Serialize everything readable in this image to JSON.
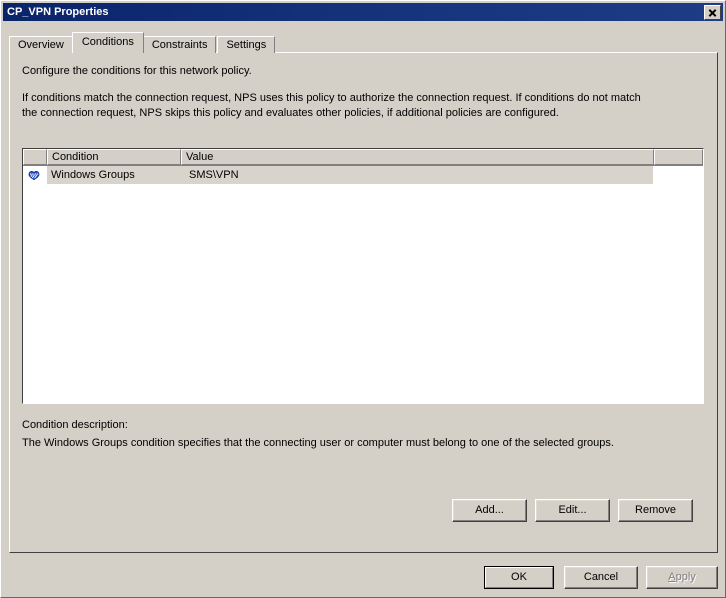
{
  "window": {
    "title": "CP_VPN Properties",
    "close_icon": "close-icon"
  },
  "tabs": [
    {
      "label": "Overview",
      "selected": false
    },
    {
      "label": "Conditions",
      "selected": true
    },
    {
      "label": "Constraints",
      "selected": false
    },
    {
      "label": "Settings",
      "selected": false
    }
  ],
  "panel": {
    "intro_line": "Configure the conditions for this network policy.",
    "detail_paragraph": "If conditions match the connection request, NPS uses this policy to authorize the connection request. If conditions do not match the connection request, NPS skips this policy and evaluates other policies, if additional policies are configured."
  },
  "listview": {
    "columns": [
      {
        "key": "icon",
        "label": ""
      },
      {
        "key": "condition",
        "label": "Condition"
      },
      {
        "key": "value",
        "label": "Value"
      },
      {
        "key": "blank",
        "label": ""
      }
    ],
    "rows": [
      {
        "icon": "windows-groups-icon",
        "condition": "Windows Groups",
        "value": "SMS\\VPN",
        "selected": true
      }
    ]
  },
  "description": {
    "label": "Condition description:",
    "text": "The Windows Groups condition specifies that the connecting user or computer must belong to one of the selected groups."
  },
  "actions": {
    "add_label": "Add...",
    "edit_label": "Edit...",
    "remove_label": "Remove"
  },
  "footer": {
    "ok_label": "OK",
    "cancel_label": "Cancel",
    "apply_label_prefix": "A",
    "apply_label_rest": "pply",
    "apply_enabled": false
  },
  "colors": {
    "titlebar_start": "#0a246a",
    "titlebar_end": "#1d3c86",
    "dialog_face": "#d4d0c8",
    "selection_inactive": "#d8d4cc",
    "icon_blue": "#2a56c6",
    "disabled_text": "#808080"
  }
}
